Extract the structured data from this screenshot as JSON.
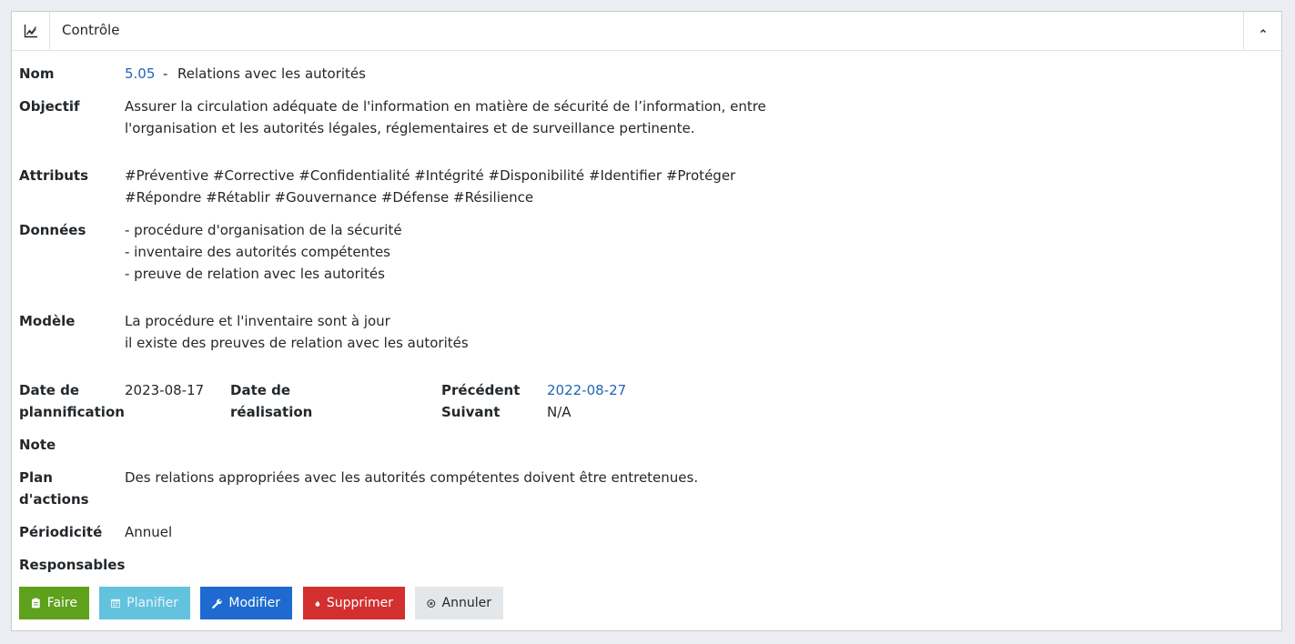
{
  "header": {
    "title": "Contrôle",
    "icon": "chart-icon",
    "collapse_icon": "chevron-up-icon"
  },
  "fields": {
    "nom_label": "Nom",
    "nom_code": "5.05",
    "nom_sep": "-",
    "nom_value": "Relations avec les autorités",
    "objectif_label": "Objectif",
    "objectif_lines": [
      "Assurer la circulation adéquate de l'information en matière de sécurité de l’information, entre",
      "l'organisation et les autorités légales, réglementaires et de surveillance pertinente."
    ],
    "attributs_label": "Attributs",
    "attributs_lines": [
      "#Préventive #Corrective #Confidentialité #Intégrité #Disponibilité #Identifier #Protéger",
      "#Répondre #Rétablir #Gouvernance #Défense #Résilience"
    ],
    "donnees_label": "Données",
    "donnees_lines": [
      "- procédure d'organisation de la sécurité",
      "- inventaire des autorités compétentes",
      "- preuve de relation avec les autorités"
    ],
    "modele_label": "Modèle",
    "modele_lines": [
      "La procédure et l'inventaire sont à jour",
      "il existe des preuves de relation avec les autorités"
    ],
    "date_planif_label_1": "Date de",
    "date_planif_label_2": "plannification",
    "date_planif_value": "2023-08-17",
    "date_real_label_1": "Date de",
    "date_real_label_2": "réalisation",
    "precedent_label": "Précédent",
    "precedent_value": "2022-08-27",
    "suivant_label": "Suivant",
    "suivant_value": "N/A",
    "note_label": "Note",
    "plan_label_1": "Plan",
    "plan_label_2": "d'actions",
    "plan_value": "Des relations appropriées avec les autorités compétentes doivent être entretenues.",
    "periodicite_label": "Périodicité",
    "periodicite_value": "Annuel",
    "responsables_label": "Responsables"
  },
  "buttons": {
    "faire": "Faire",
    "planifier": "Planifier",
    "modifier": "Modifier",
    "supprimer": "Supprimer",
    "annuler": "Annuler"
  },
  "colors": {
    "faire": "#5ea11c",
    "planifier": "#63c2de",
    "modifier": "#1e6ad0",
    "supprimer": "#d32f2f",
    "annuler": "#e4e7ea",
    "link": "#2165b8"
  }
}
